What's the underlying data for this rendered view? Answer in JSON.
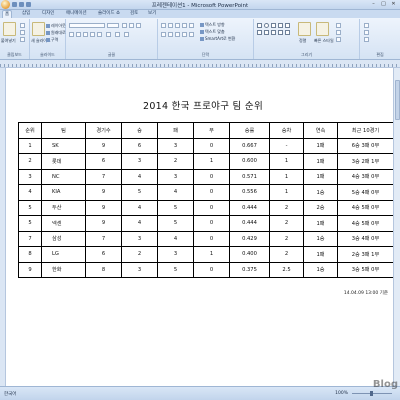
{
  "window": {
    "title": "프레젠테이션1 - Microsoft PowerPoint"
  },
  "tabs": [
    "홈",
    "삽입",
    "디자인",
    "애니메이션",
    "슬라이드 쇼",
    "검토",
    "보기"
  ],
  "ribbon": {
    "groups": [
      {
        "label": "클립보드"
      },
      {
        "label": "슬라이드"
      },
      {
        "label": "글꼴"
      },
      {
        "label": "단락"
      },
      {
        "label": "그리기"
      },
      {
        "label": "편집"
      }
    ],
    "paste_label": "붙여넣기",
    "new_slide_label": "새 슬라이드",
    "layout_label": "레이아웃",
    "reset_label": "원래대로",
    "section_label": "구역",
    "text_direction_label": "텍스트 방향",
    "text_align_label": "텍스트 맞춤",
    "smartart_label": "SmartArt로 변환",
    "arrange_label": "정렬",
    "quick_styles_label": "빠른 스타일"
  },
  "slide": {
    "title": "2014 한국 프로야구 팀 순위",
    "columns": [
      "순위",
      "팀",
      "경기수",
      "승",
      "패",
      "무",
      "승률",
      "승차",
      "연속",
      "최근 10경기"
    ],
    "rows": [
      [
        "1",
        "SK",
        "9",
        "6",
        "3",
        "0",
        "0.667",
        "-",
        "1패",
        "6승 3패 0무"
      ],
      [
        "2",
        "롯데",
        "6",
        "3",
        "2",
        "1",
        "0.600",
        "1",
        "1패",
        "3승 2패 1무"
      ],
      [
        "3",
        "NC",
        "7",
        "4",
        "3",
        "0",
        "0.571",
        "1",
        "1패",
        "4승 3패 0무"
      ],
      [
        "4",
        "KIA",
        "9",
        "5",
        "4",
        "0",
        "0.556",
        "1",
        "1승",
        "5승 4패 0무"
      ],
      [
        "5",
        "두산",
        "9",
        "4",
        "5",
        "0",
        "0.444",
        "2",
        "2승",
        "4승 5패 0무"
      ],
      [
        "5",
        "넥센",
        "9",
        "4",
        "5",
        "0",
        "0.444",
        "2",
        "1패",
        "4승 5패 0무"
      ],
      [
        "7",
        "삼성",
        "7",
        "3",
        "4",
        "0",
        "0.429",
        "2",
        "1승",
        "3승 4패 0무"
      ],
      [
        "8",
        "LG",
        "6",
        "2",
        "3",
        "1",
        "0.400",
        "2",
        "1패",
        "2승 3패 1무"
      ],
      [
        "9",
        "한화",
        "8",
        "3",
        "5",
        "0",
        "0.375",
        "2.5",
        "1승",
        "3승 5패 0무"
      ]
    ],
    "footnote": "14.04.09  13:00 기준"
  },
  "status": {
    "language": "한국어",
    "zoom": "100%"
  },
  "watermark": "Blog"
}
